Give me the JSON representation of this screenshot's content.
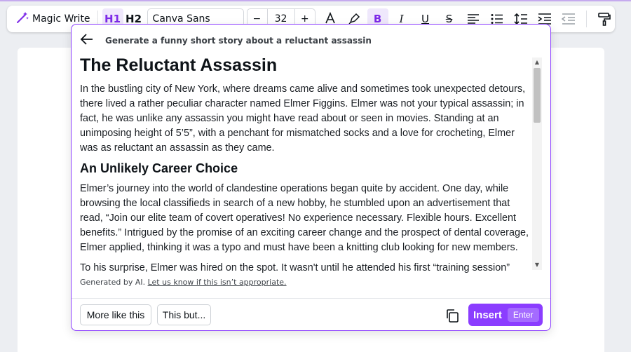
{
  "toolbar": {
    "magic_write_label": "Magic Write",
    "h1_label": "H1",
    "h2_label": "H2",
    "font_name": "Canva Sans",
    "size_minus": "−",
    "font_size": "32",
    "size_plus": "+",
    "bold_glyph": "B",
    "italic_glyph": "I",
    "underline_glyph": "U",
    "strike_glyph": "S",
    "accent_color": "#7d2ae8"
  },
  "panel": {
    "prompt": "Generate a funny short story about a reluctant assassin",
    "title": "The Reluctant Assassin",
    "para1": "In the bustling city of New York, where dreams came alive and sometimes took unexpected detours, there lived a rather peculiar character named Elmer Figgins. Elmer was not your typical assassin; in fact, he was unlike any assassin you might have read about or seen in movies. Standing at an unimposing height of 5’5”, with a penchant for mismatched socks and a love for crocheting, Elmer was as reluctant an assassin as they came.",
    "subheading": "An Unlikely Career Choice",
    "para2": "Elmer’s journey into the world of clandestine operations began quite by accident. One day, while browsing the local classifieds in search of a new hobby, he stumbled upon an advertisement that read, “Join our elite team of covert operatives! No experience necessary. Flexible hours. Excellent benefits.” Intrigued by the promise of an exciting career change and the prospect of dental coverage, Elmer applied, thinking it was a typo and must have been a knitting club looking for new members.",
    "para3": "To his surprise, Elmer was hired on the spot. It wasn't until he attended his first “training session”",
    "disclaimer_prefix": "Generated by AI.",
    "disclaimer_link": "Let us know if this isn’t appropriate.",
    "more_like_this": "More like this",
    "this_but": "This but...",
    "insert_label": "Insert",
    "insert_shortcut": "Enter",
    "insert_color": "#8b3dff"
  }
}
